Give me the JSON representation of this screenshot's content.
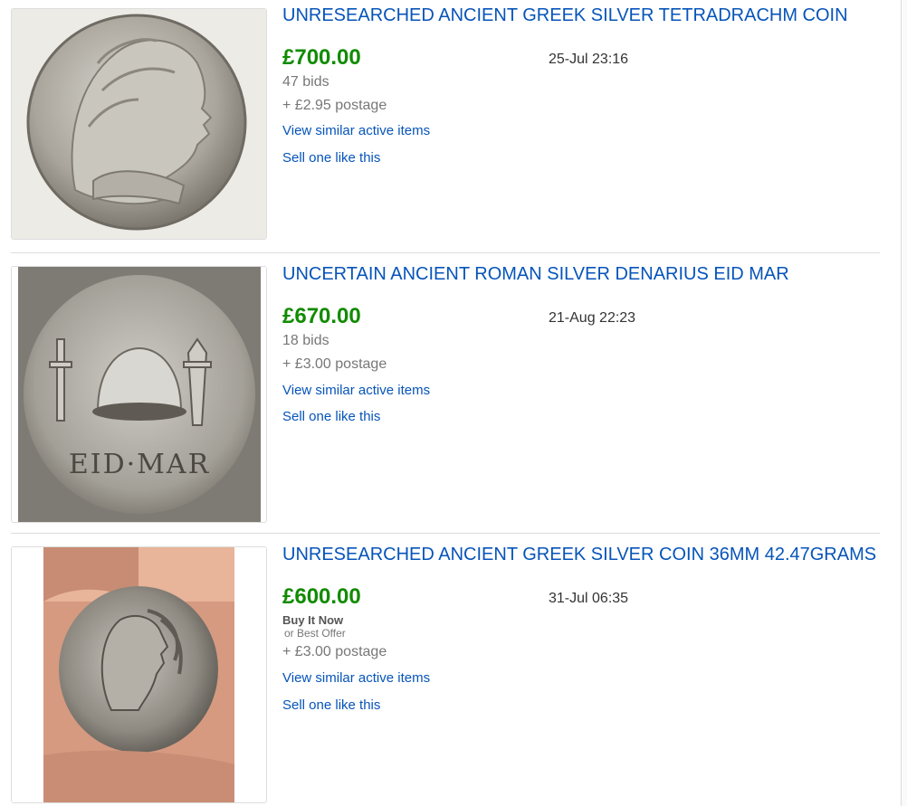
{
  "listings": [
    {
      "title": "UNRESEARCHED ANCIENT GREEK SILVER TETRADRACHM COIN",
      "price": "£700.00",
      "bids": "47 bids",
      "postage": "+ £2.95 postage",
      "end_time": "25-Jul 23:16",
      "similar_link": "View similar active items",
      "sell_link": "Sell one like this",
      "image": "coin-greek-head-photo"
    },
    {
      "title": "UNCERTAIN ANCIENT ROMAN SILVER DENARIUS EID MAR",
      "price": "£670.00",
      "bids": "18 bids",
      "postage": "+ £3.00 postage",
      "end_time": "21-Aug 22:23",
      "similar_link": "View similar active items",
      "sell_link": "Sell one like this",
      "image": "coin-eid-mar-photo",
      "coin_inscription": "EID·MAR"
    },
    {
      "title": "UNRESEARCHED ANCIENT GREEK SILVER COIN 36MM 42.47GRAMS",
      "price": "£600.00",
      "buy_it_now": "Buy It Now",
      "best_offer": "or Best Offer",
      "postage": "+ £3.00 postage",
      "end_time": "31-Jul 06:35",
      "similar_link": "View similar active items",
      "sell_link": "Sell one like this",
      "image": "coin-in-hand-photo"
    }
  ],
  "colors": {
    "link": "#0654ba",
    "price": "#118b00",
    "muted": "#777777",
    "divider": "#dddddd"
  }
}
